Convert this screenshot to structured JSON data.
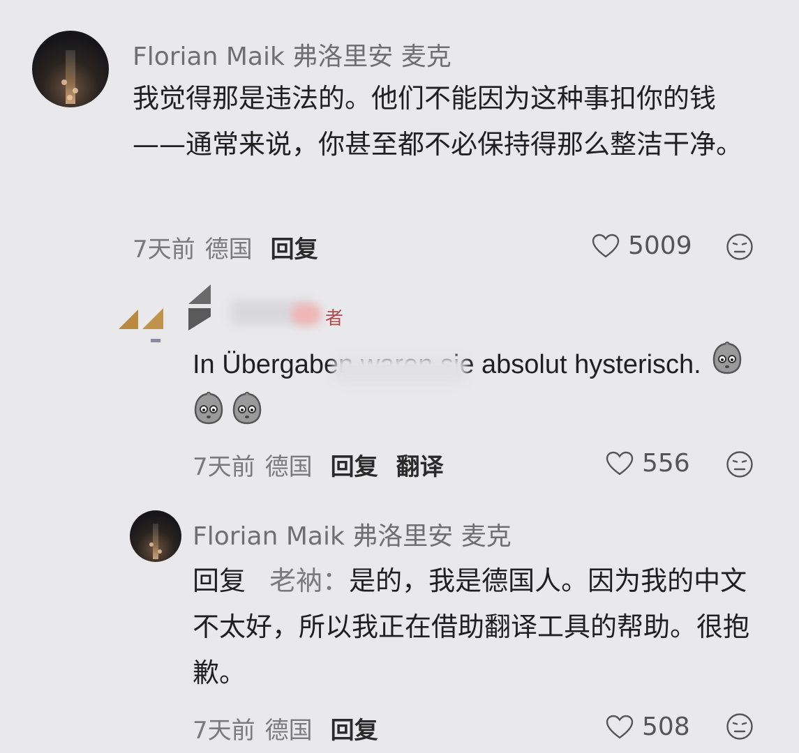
{
  "comments": [
    {
      "username": "Florian Maik 弗洛里安 麦克",
      "text": "我觉得那是违法的。他们不能因为这种事扣你的钱——通常来说，你甚至都不必保持得那么整洁干净。",
      "time": "7天前",
      "location": "德国",
      "reply_label": "回复",
      "likes": "5009"
    },
    {
      "author_tag": "者",
      "text": "In Übergaben waren sie absolut hysterisch.",
      "time": "7天前",
      "location": "德国",
      "reply_label": "回复",
      "translate_label": "翻译",
      "likes": "556"
    },
    {
      "username": "Florian Maik 弗洛里安 麦克",
      "reply_prefix": "回复",
      "reply_to": "老衲：",
      "text": "是的，我是德国人。因为我的中文不太好，所以我正在借助翻译工具的帮助。很抱歉。",
      "time": "7天前",
      "location": "德国",
      "reply_label": "回复",
      "likes": "508"
    }
  ],
  "icons": {
    "like": "heart-outline-icon",
    "dislike": "neutral-face-icon",
    "emoji": "ghost-face-emoji"
  }
}
